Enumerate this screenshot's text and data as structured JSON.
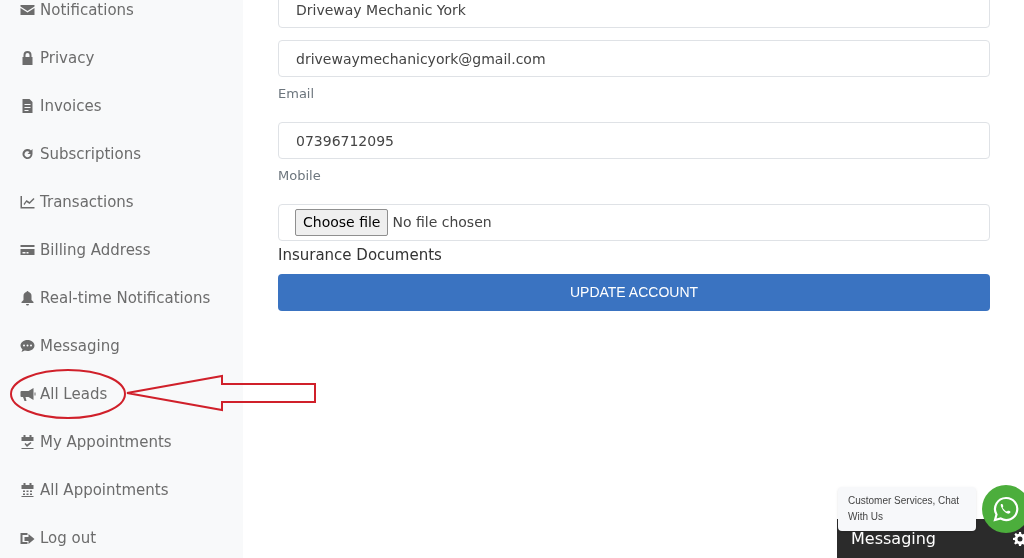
{
  "sidebar": {
    "items": [
      {
        "label": "Notifications"
      },
      {
        "label": "Privacy"
      },
      {
        "label": "Invoices"
      },
      {
        "label": "Subscriptions"
      },
      {
        "label": "Transactions"
      },
      {
        "label": "Billing Address"
      },
      {
        "label": "Real-time Notifications"
      },
      {
        "label": "Messaging"
      },
      {
        "label": "All Leads"
      },
      {
        "label": "My Appointments"
      },
      {
        "label": "All Appointments"
      },
      {
        "label": "Log out"
      }
    ]
  },
  "form": {
    "fields": [
      {
        "kind": "text",
        "value": "Driveway Mechanic York"
      },
      {
        "kind": "text",
        "value": "drivewaymechanicyork@gmail.com",
        "label": "Email"
      },
      {
        "kind": "text",
        "value": "07396712095",
        "label": "Mobile"
      },
      {
        "kind": "file",
        "button": "Choose file",
        "status": "No file chosen",
        "label": "Insurance Documents"
      }
    ],
    "submit": "UPDATE ACCOUNT"
  },
  "chat_widget": {
    "tooltip": "Customer Services, Chat With Us",
    "bar_title": "Messaging"
  }
}
